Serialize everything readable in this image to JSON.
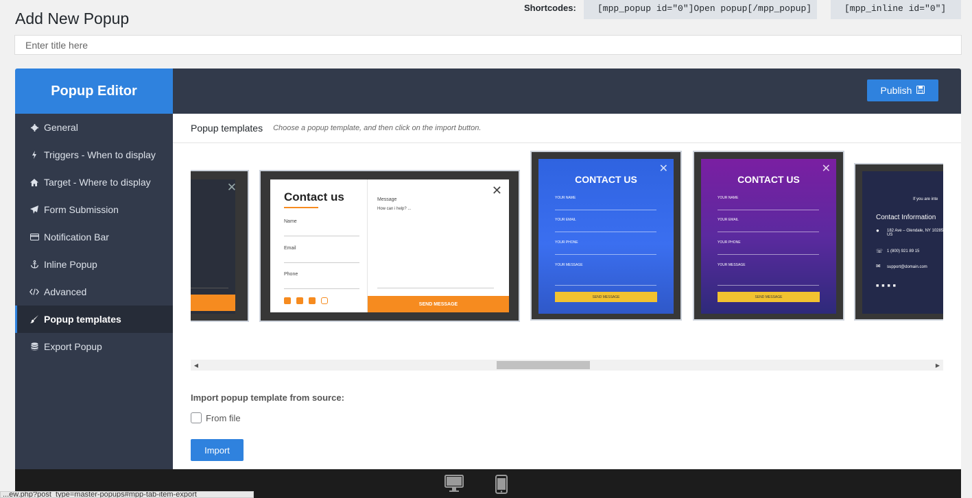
{
  "page": {
    "title": "Add New Popup",
    "shortcodes_label": "Shortcodes:",
    "shortcode_popup": "[mpp_popup id=\"0\"]Open popup[/mpp_popup]",
    "shortcode_inline": "[mpp_inline id=\"0\"]",
    "title_placeholder": "Enter title here"
  },
  "editor": {
    "brand": "Popup Editor",
    "publish_label": "Publish",
    "sidebar": [
      {
        "label": "General",
        "icon": "gear-icon"
      },
      {
        "label": "Triggers - When to display",
        "icon": "bolt-icon"
      },
      {
        "label": "Target - Where to display",
        "icon": "home-icon"
      },
      {
        "label": "Form Submission",
        "icon": "paper-plane-icon"
      },
      {
        "label": "Notification Bar",
        "icon": "credit-card-icon"
      },
      {
        "label": "Inline Popup",
        "icon": "anchor-icon"
      },
      {
        "label": "Advanced",
        "icon": "code-icon"
      },
      {
        "label": "Popup templates",
        "icon": "paint-brush-icon",
        "active": true
      },
      {
        "label": "Export Popup",
        "icon": "database-icon"
      }
    ]
  },
  "templates_section": {
    "title": "Popup templates",
    "hint": "Choose a popup template, and then click on the import button.",
    "template2": {
      "heading": "Contact us",
      "name": "Name",
      "email": "Email",
      "phone": "Phone",
      "message": "Message",
      "message_placeholder": "How can i help? ...",
      "button": "SEND MESSAGE"
    },
    "template3": {
      "heading": "CONTACT US",
      "name": "YOUR NAME",
      "email": "YOUR EMAIL",
      "phone": "YOUR PHONE",
      "message": "YOUR MESSAGE",
      "button": "SEND MESSAGE"
    },
    "template4": {
      "heading": "CONTACT US",
      "name": "YOUR NAME",
      "email": "YOUR EMAIL",
      "phone": "YOUR PHONE",
      "message": "YOUR MESSAGE",
      "button": "SEND MESSAGE"
    },
    "template5": {
      "intro": "If you are inte",
      "heading": "Contact Information",
      "address": "182 Ave – Glendale, NY 10285, US",
      "phone": "1 (800) 921 89 15",
      "email": "support@domain.com"
    }
  },
  "import_section": {
    "label": "Import popup template from source:",
    "from_file": "From file",
    "import_button": "Import"
  },
  "colors": {
    "accent": "#2f82de",
    "sidebar_bg": "#323a4b",
    "orange": "#f68b1f"
  },
  "status_bar": {
    "url": "...ew.php?post_type=master-popups#mpp-tab-item-export"
  }
}
